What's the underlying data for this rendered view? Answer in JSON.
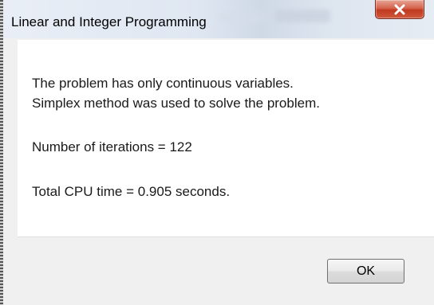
{
  "dialog": {
    "title": "Linear and Integer Programming",
    "close_label": "X",
    "messages": {
      "line1": "The problem has only continuous variables.",
      "line2": "Simplex method was used to solve the problem.",
      "iterations": "Number of iterations = 122",
      "cpu_time": "Total CPU time = 0.905 seconds."
    },
    "ok_label": "OK"
  },
  "icons": {
    "close": "close-icon"
  },
  "colors": {
    "close_button": "#c9452b",
    "title_bar": "#dfe7f2",
    "dialog_background": "#f0f0f0",
    "content_background": "#ffffff"
  }
}
